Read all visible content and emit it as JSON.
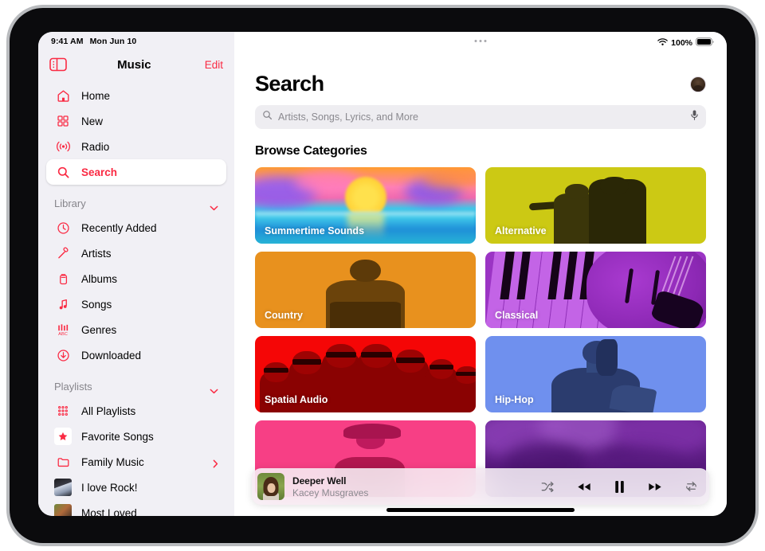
{
  "status_bar": {
    "time": "9:41 AM",
    "date": "Mon Jun 10",
    "wifi_icon": "wifi-icon",
    "battery_percent": "100%",
    "battery_icon": "battery-full-icon"
  },
  "sidebar": {
    "toggle_icon": "sidebar-toggle-icon",
    "title": "Music",
    "edit_label": "Edit",
    "nav_items": [
      {
        "label": "Home",
        "icon": "house-icon",
        "selected": false
      },
      {
        "label": "New",
        "icon": "grid-squares-icon",
        "selected": false
      },
      {
        "label": "Radio",
        "icon": "radio-broadcast-icon",
        "selected": false
      },
      {
        "label": "Search",
        "icon": "search-icon",
        "selected": true
      }
    ],
    "library_section": {
      "label": "Library",
      "chevron_icon": "chevron-down-icon",
      "items": [
        {
          "label": "Recently Added",
          "icon": "clock-icon"
        },
        {
          "label": "Artists",
          "icon": "microphone-icon"
        },
        {
          "label": "Albums",
          "icon": "album-stack-icon"
        },
        {
          "label": "Songs",
          "icon": "music-note-icon"
        },
        {
          "label": "Genres",
          "icon": "genres-abc-icon"
        },
        {
          "label": "Downloaded",
          "icon": "download-arrow-icon"
        }
      ]
    },
    "playlists_section": {
      "label": "Playlists",
      "chevron_icon": "chevron-down-icon",
      "items": [
        {
          "label": "All Playlists",
          "icon": "playlist-grid-icon",
          "artwork": false,
          "disclosure": false
        },
        {
          "label": "Favorite Songs",
          "icon": "star-icon",
          "artwork": false,
          "disclosure": false
        },
        {
          "label": "Family Music",
          "icon": "folder-icon",
          "artwork": false,
          "disclosure": true,
          "disclosure_icon": "chevron-right-icon"
        },
        {
          "label": "I love Rock!",
          "icon": "playlist-artwork",
          "artwork": true,
          "disclosure": false
        },
        {
          "label": "Most Loved",
          "icon": "playlist-artwork",
          "artwork": true,
          "disclosure": false
        }
      ]
    }
  },
  "main": {
    "grabber_icon": "window-grabber-icon",
    "page_title": "Search",
    "avatar_icon": "user-avatar",
    "search": {
      "icon": "search-icon",
      "value": "",
      "placeholder": "Artists, Songs, Lyrics, and More",
      "mic_icon": "microphone-icon"
    },
    "browse_heading": "Browse Categories",
    "categories": [
      {
        "label": "Summertime Sounds",
        "art": "sunset",
        "color": "#ff9d2e"
      },
      {
        "label": "Alternative",
        "art": "duo-alt",
        "color": "#ccc914"
      },
      {
        "label": "Country",
        "art": "duo-country",
        "color": "#e8911e"
      },
      {
        "label": "Classical",
        "art": "duo-classical",
        "color": "#9b34c4"
      },
      {
        "label": "Spatial Audio",
        "art": "duo-spatial",
        "color": "#f50606"
      },
      {
        "label": "Hip-Hop",
        "art": "duo-hiphop",
        "color": "#6f90ee"
      },
      {
        "label": "",
        "art": "duo-pink",
        "color": "#f73f85"
      },
      {
        "label": "",
        "art": "duo-purple",
        "color": "#6d2595"
      }
    ]
  },
  "now_playing": {
    "artwork_icon": "album-artwork",
    "title": "Deeper Well",
    "artist": "Kacey Musgraves",
    "controls": [
      {
        "name": "shuffle-button",
        "icon": "shuffle-icon"
      },
      {
        "name": "rewind-button",
        "icon": "rewind-icon"
      },
      {
        "name": "pause-button",
        "icon": "pause-icon"
      },
      {
        "name": "fast-forward-button",
        "icon": "fast-forward-icon"
      },
      {
        "name": "repeat-button",
        "icon": "repeat-icon"
      }
    ]
  },
  "colors": {
    "accent": "#fa2a43",
    "sidebar_bg": "#f1f0f5",
    "field_bg": "#eeedf1"
  }
}
